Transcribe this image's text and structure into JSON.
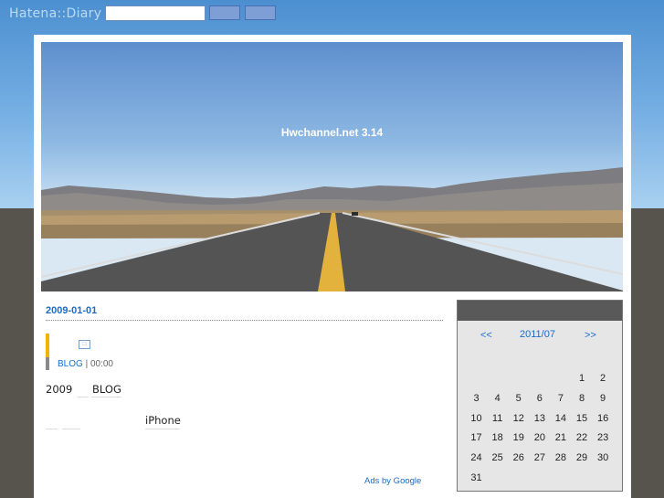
{
  "topbar": {
    "logo": "Hatena::Diary",
    "search_value": "",
    "button_1": "",
    "button_2": ""
  },
  "banner": {
    "title": "Hwchannel.net 3.14"
  },
  "entry": {
    "date": "2009-01-01",
    "category": "BLOG",
    "time_separator": " | ",
    "time": "00:00",
    "body_year": "2009",
    "body_blog": "BLOG",
    "body_iphone": "iPhone"
  },
  "ads": {
    "label": "Ads by Google"
  },
  "calendar": {
    "prev": "<<",
    "month": "2011/07",
    "next": ">>",
    "weeks": [
      [
        "",
        "",
        "",
        "",
        "",
        "1",
        "2"
      ],
      [
        "3",
        "4",
        "5",
        "6",
        "7",
        "8",
        "9"
      ],
      [
        "10",
        "11",
        "12",
        "13",
        "14",
        "15",
        "16"
      ],
      [
        "17",
        "18",
        "19",
        "20",
        "21",
        "22",
        "23"
      ],
      [
        "24",
        "25",
        "26",
        "27",
        "28",
        "29",
        "30"
      ],
      [
        "31",
        "",
        "",
        "",
        "",
        "",
        ""
      ]
    ]
  },
  "colors": {
    "link": "#1a6cc8",
    "accent_yellow": "#f2b400",
    "calendar_header": "#595959",
    "page_dark": "#57544e"
  }
}
